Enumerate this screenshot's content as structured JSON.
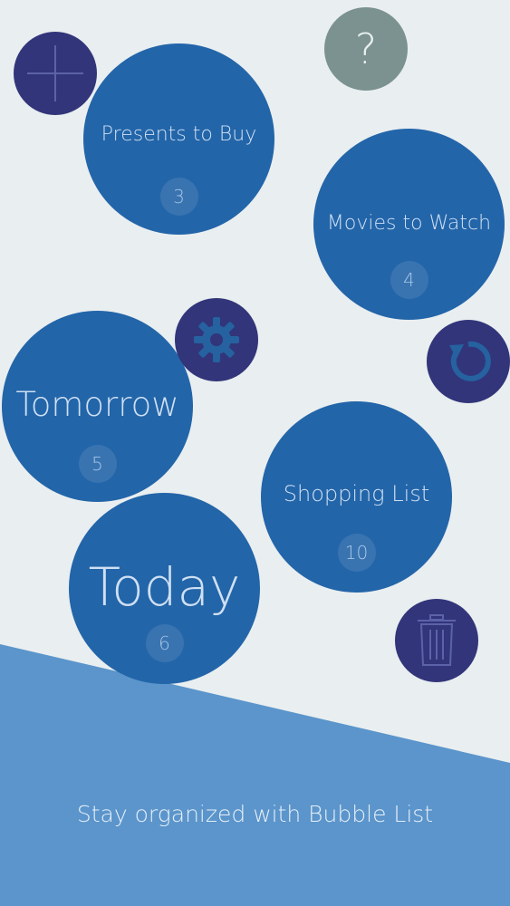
{
  "colors": {
    "background": "#e9eef0",
    "bubble": "#2365a9",
    "action_circle": "#32357a",
    "help_circle": "#7b9290",
    "banner": "#5b95cb"
  },
  "actions": {
    "add": {
      "icon": "plus-icon"
    },
    "help": {
      "icon": "question-icon",
      "glyph": "?"
    },
    "settings": {
      "icon": "gear-icon"
    },
    "undo": {
      "icon": "refresh-icon"
    },
    "trash": {
      "icon": "trash-icon"
    }
  },
  "lists": [
    {
      "title": "Presents to Buy",
      "count": "3"
    },
    {
      "title": "Movies to Watch",
      "count": "4"
    },
    {
      "title": "Tomorrow",
      "count": "5"
    },
    {
      "title": "Shopping List",
      "count": "10"
    },
    {
      "title": "Today",
      "count": "6"
    }
  ],
  "banner": {
    "tagline": "Stay organized with Bubble List"
  }
}
